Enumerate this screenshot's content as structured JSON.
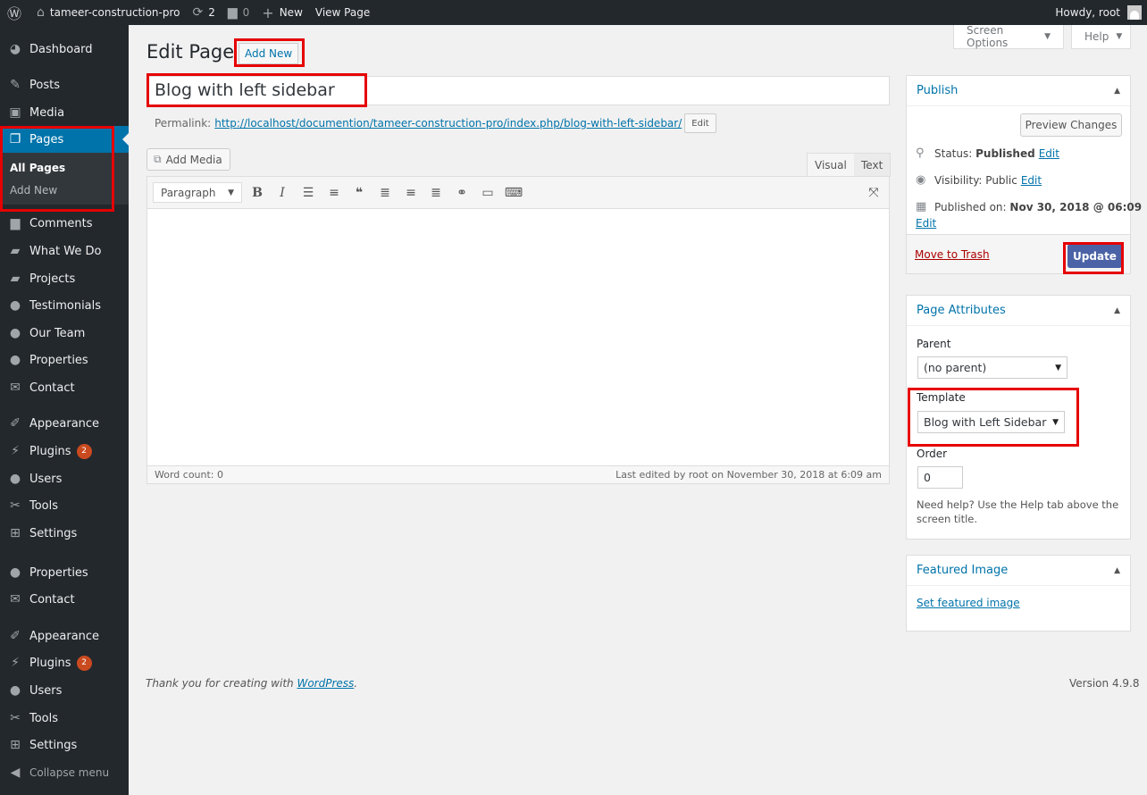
{
  "adminbar": {
    "site_name": "tameer-construction-pro",
    "updates_count": "2",
    "comments_count": "0",
    "new_label": "New",
    "view_page_label": "View Page",
    "howdy": "Howdy, root"
  },
  "sidebar": {
    "items": [
      {
        "label": "Dashboard",
        "icon": "dashboard-icon"
      },
      {
        "label": "Posts",
        "icon": "pin-icon"
      },
      {
        "label": "Media",
        "icon": "media-icon"
      },
      {
        "label": "Pages",
        "icon": "pages-icon"
      },
      {
        "label": "Comments",
        "icon": "comment-icon"
      },
      {
        "label": "What We Do",
        "icon": "folder-icon"
      },
      {
        "label": "Projects",
        "icon": "folder-icon"
      },
      {
        "label": "Testimonials",
        "icon": "user-icon"
      },
      {
        "label": "Our Team",
        "icon": "user-icon"
      },
      {
        "label": "Properties",
        "icon": "user-icon"
      },
      {
        "label": "Contact",
        "icon": "mail-icon"
      },
      {
        "label": "Appearance",
        "icon": "brush-icon"
      },
      {
        "label": "Plugins",
        "icon": "plugin-icon",
        "badge": "2"
      },
      {
        "label": "Users",
        "icon": "user-icon"
      },
      {
        "label": "Tools",
        "icon": "wrench-icon"
      },
      {
        "label": "Settings",
        "icon": "settings-icon"
      },
      {
        "label": "Properties",
        "icon": "user-icon"
      },
      {
        "label": "Contact",
        "icon": "mail-icon"
      },
      {
        "label": "Appearance",
        "icon": "brush-icon"
      },
      {
        "label": "Plugins",
        "icon": "plugin-icon",
        "badge": "2"
      },
      {
        "label": "Users",
        "icon": "user-icon"
      },
      {
        "label": "Tools",
        "icon": "wrench-icon"
      },
      {
        "label": "Settings",
        "icon": "settings-icon"
      }
    ],
    "submenu": {
      "all_pages": "All Pages",
      "add_new": "Add New"
    },
    "collapse": "Collapse menu"
  },
  "screen_options": "Screen Options",
  "help": "Help",
  "page": {
    "title": "Edit Page",
    "add_new": "Add New",
    "post_title": "Blog with left sidebar",
    "permalink_label": "Permalink:",
    "permalink_url": "http://localhost/documention/tameer-construction-pro/index.php/",
    "permalink_slug": "blog-with-left-sidebar",
    "permalink_slash": "/",
    "permalink_edit": "Edit"
  },
  "editor": {
    "add_media": "Add Media",
    "tab_visual": "Visual",
    "tab_text": "Text",
    "format": "Paragraph",
    "word_count": "Word count: 0",
    "last_edited": "Last edited by root on November 30, 2018 at 6:09 am"
  },
  "publish": {
    "title": "Publish",
    "preview": "Preview Changes",
    "status_label": "Status:",
    "status_value": "Published",
    "visibility_label": "Visibility:",
    "visibility_value": "Public",
    "published_label": "Published on:",
    "published_value": "Nov 30, 2018 @ 06:09",
    "edit": "Edit",
    "trash": "Move to Trash",
    "update": "Update"
  },
  "page_attributes": {
    "title": "Page Attributes",
    "parent_label": "Parent",
    "parent_value": "(no parent)",
    "template_label": "Template",
    "template_value": "Blog with Left Sidebar",
    "order_label": "Order",
    "order_value": "0",
    "help": "Need help? Use the Help tab above the screen title."
  },
  "featured_image": {
    "title": "Featured Image",
    "set_link": "Set featured image"
  },
  "footer": {
    "thanks_prefix": "Thank you for creating with ",
    "wordpress": "WordPress",
    "thanks_suffix": ".",
    "version": "Version 4.9.8"
  }
}
